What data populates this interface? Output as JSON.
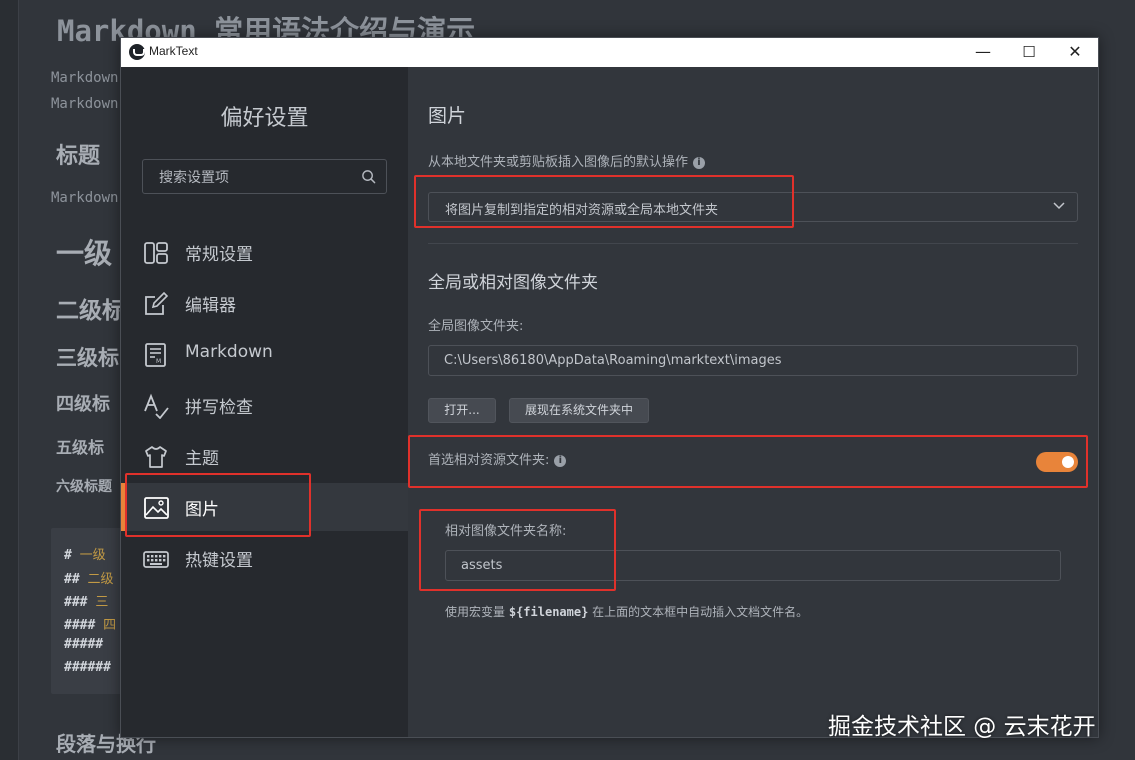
{
  "background_doc": {
    "title": "Markdown 常用语法介绍与演示",
    "line1": "Markdown",
    "line2": "Markdown",
    "heading_section": "标题",
    "line3": "Markdown",
    "h1": "一级",
    "h2": "二级标",
    "h3": "三级标",
    "h4": "四级标",
    "h5": "五级标",
    "h6": "六级标题",
    "code_lines": [
      {
        "hash": "#",
        "text": "一级"
      },
      {
        "hash": "##",
        "text": "二级"
      },
      {
        "hash": "###",
        "text": "三"
      },
      {
        "hash": "####",
        "text": "四"
      },
      {
        "hash": "#####",
        "text": ""
      },
      {
        "hash": "######",
        "text": ""
      }
    ],
    "bottom_heading": "段落与换行"
  },
  "window": {
    "app_name": "MarkText",
    "minimize": "—",
    "maximize": "☐",
    "close": "✕"
  },
  "sidebar": {
    "title": "偏好设置",
    "search_placeholder": "搜索设置项",
    "items": [
      {
        "label": "常规设置",
        "icon": "layout-icon"
      },
      {
        "label": "编辑器",
        "icon": "edit-icon"
      },
      {
        "label": "Markdown",
        "icon": "markdown-icon"
      },
      {
        "label": "拼写检查",
        "icon": "spellcheck-icon"
      },
      {
        "label": "主题",
        "icon": "theme-shirt-icon"
      },
      {
        "label": "图片",
        "icon": "image-icon",
        "active": true
      },
      {
        "label": "热键设置",
        "icon": "keyboard-icon"
      }
    ]
  },
  "main": {
    "section_title": "图片",
    "insert_action_label": "从本地文件夹或剪贴板插入图像后的默认操作",
    "insert_action_value": "将图片复制到指定的相对资源或全局本地文件夹",
    "folder_section_title": "全局或相对图像文件夹",
    "global_folder_label": "全局图像文件夹:",
    "global_folder_value": "C:\\Users\\86180\\AppData\\Roaming\\marktext\\images",
    "open_button": "打开...",
    "show_in_folder_button": "展现在系统文件夹中",
    "prefer_relative_label": "首选相对资源文件夹:",
    "prefer_relative_enabled": true,
    "relative_name_label": "相对图像文件夹名称:",
    "relative_name_value": "assets",
    "hint_prefix": "使用宏变量",
    "hint_macro": "${filename}",
    "hint_suffix": "在上面的文本框中自动插入文档文件名。"
  },
  "colors": {
    "accent": "#e8843a",
    "annotation_red": "#e0312b",
    "sidebar_bg": "#26292e",
    "content_bg": "#32363c"
  },
  "watermark": "掘金技术社区 @ 云末花开"
}
